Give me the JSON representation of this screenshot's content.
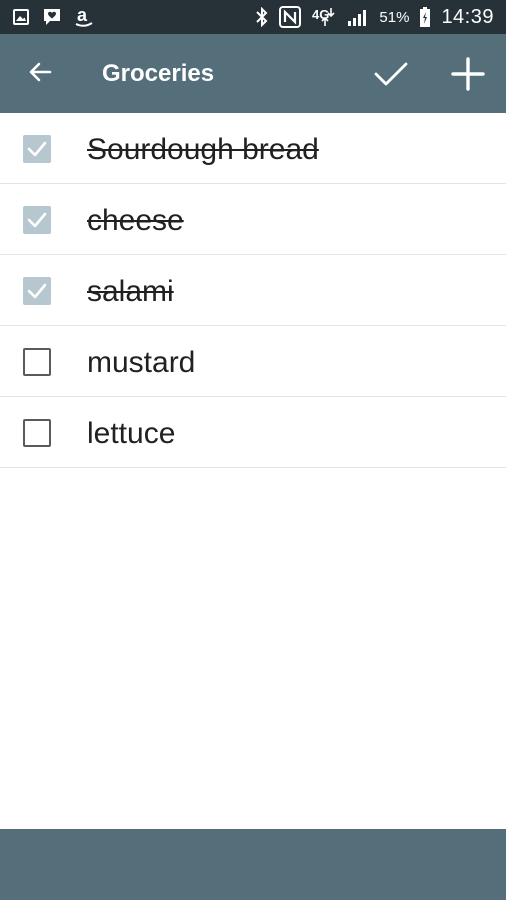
{
  "status_bar": {
    "battery": "51%",
    "time": "14:39",
    "left_icons": [
      "gallery-icon",
      "message-icon",
      "amazon-icon"
    ],
    "right_icons": [
      "bluetooth-icon",
      "nfc-icon",
      "4g-icon",
      "signal-icon",
      "battery-icon"
    ]
  },
  "app_bar": {
    "title": "Groceries",
    "back_icon": "arrow-back-icon",
    "done_icon": "check-icon",
    "add_icon": "plus-icon"
  },
  "items": [
    {
      "label": "Sourdough bread",
      "checked": true
    },
    {
      "label": "cheese",
      "checked": true
    },
    {
      "label": "salami",
      "checked": true
    },
    {
      "label": "mustard",
      "checked": false
    },
    {
      "label": "lettuce",
      "checked": false
    }
  ],
  "colors": {
    "status_bar": "#263238",
    "app_bar": "#546e7a",
    "checked_box": "#b7c7cf",
    "divider": "#e4e4e4"
  }
}
